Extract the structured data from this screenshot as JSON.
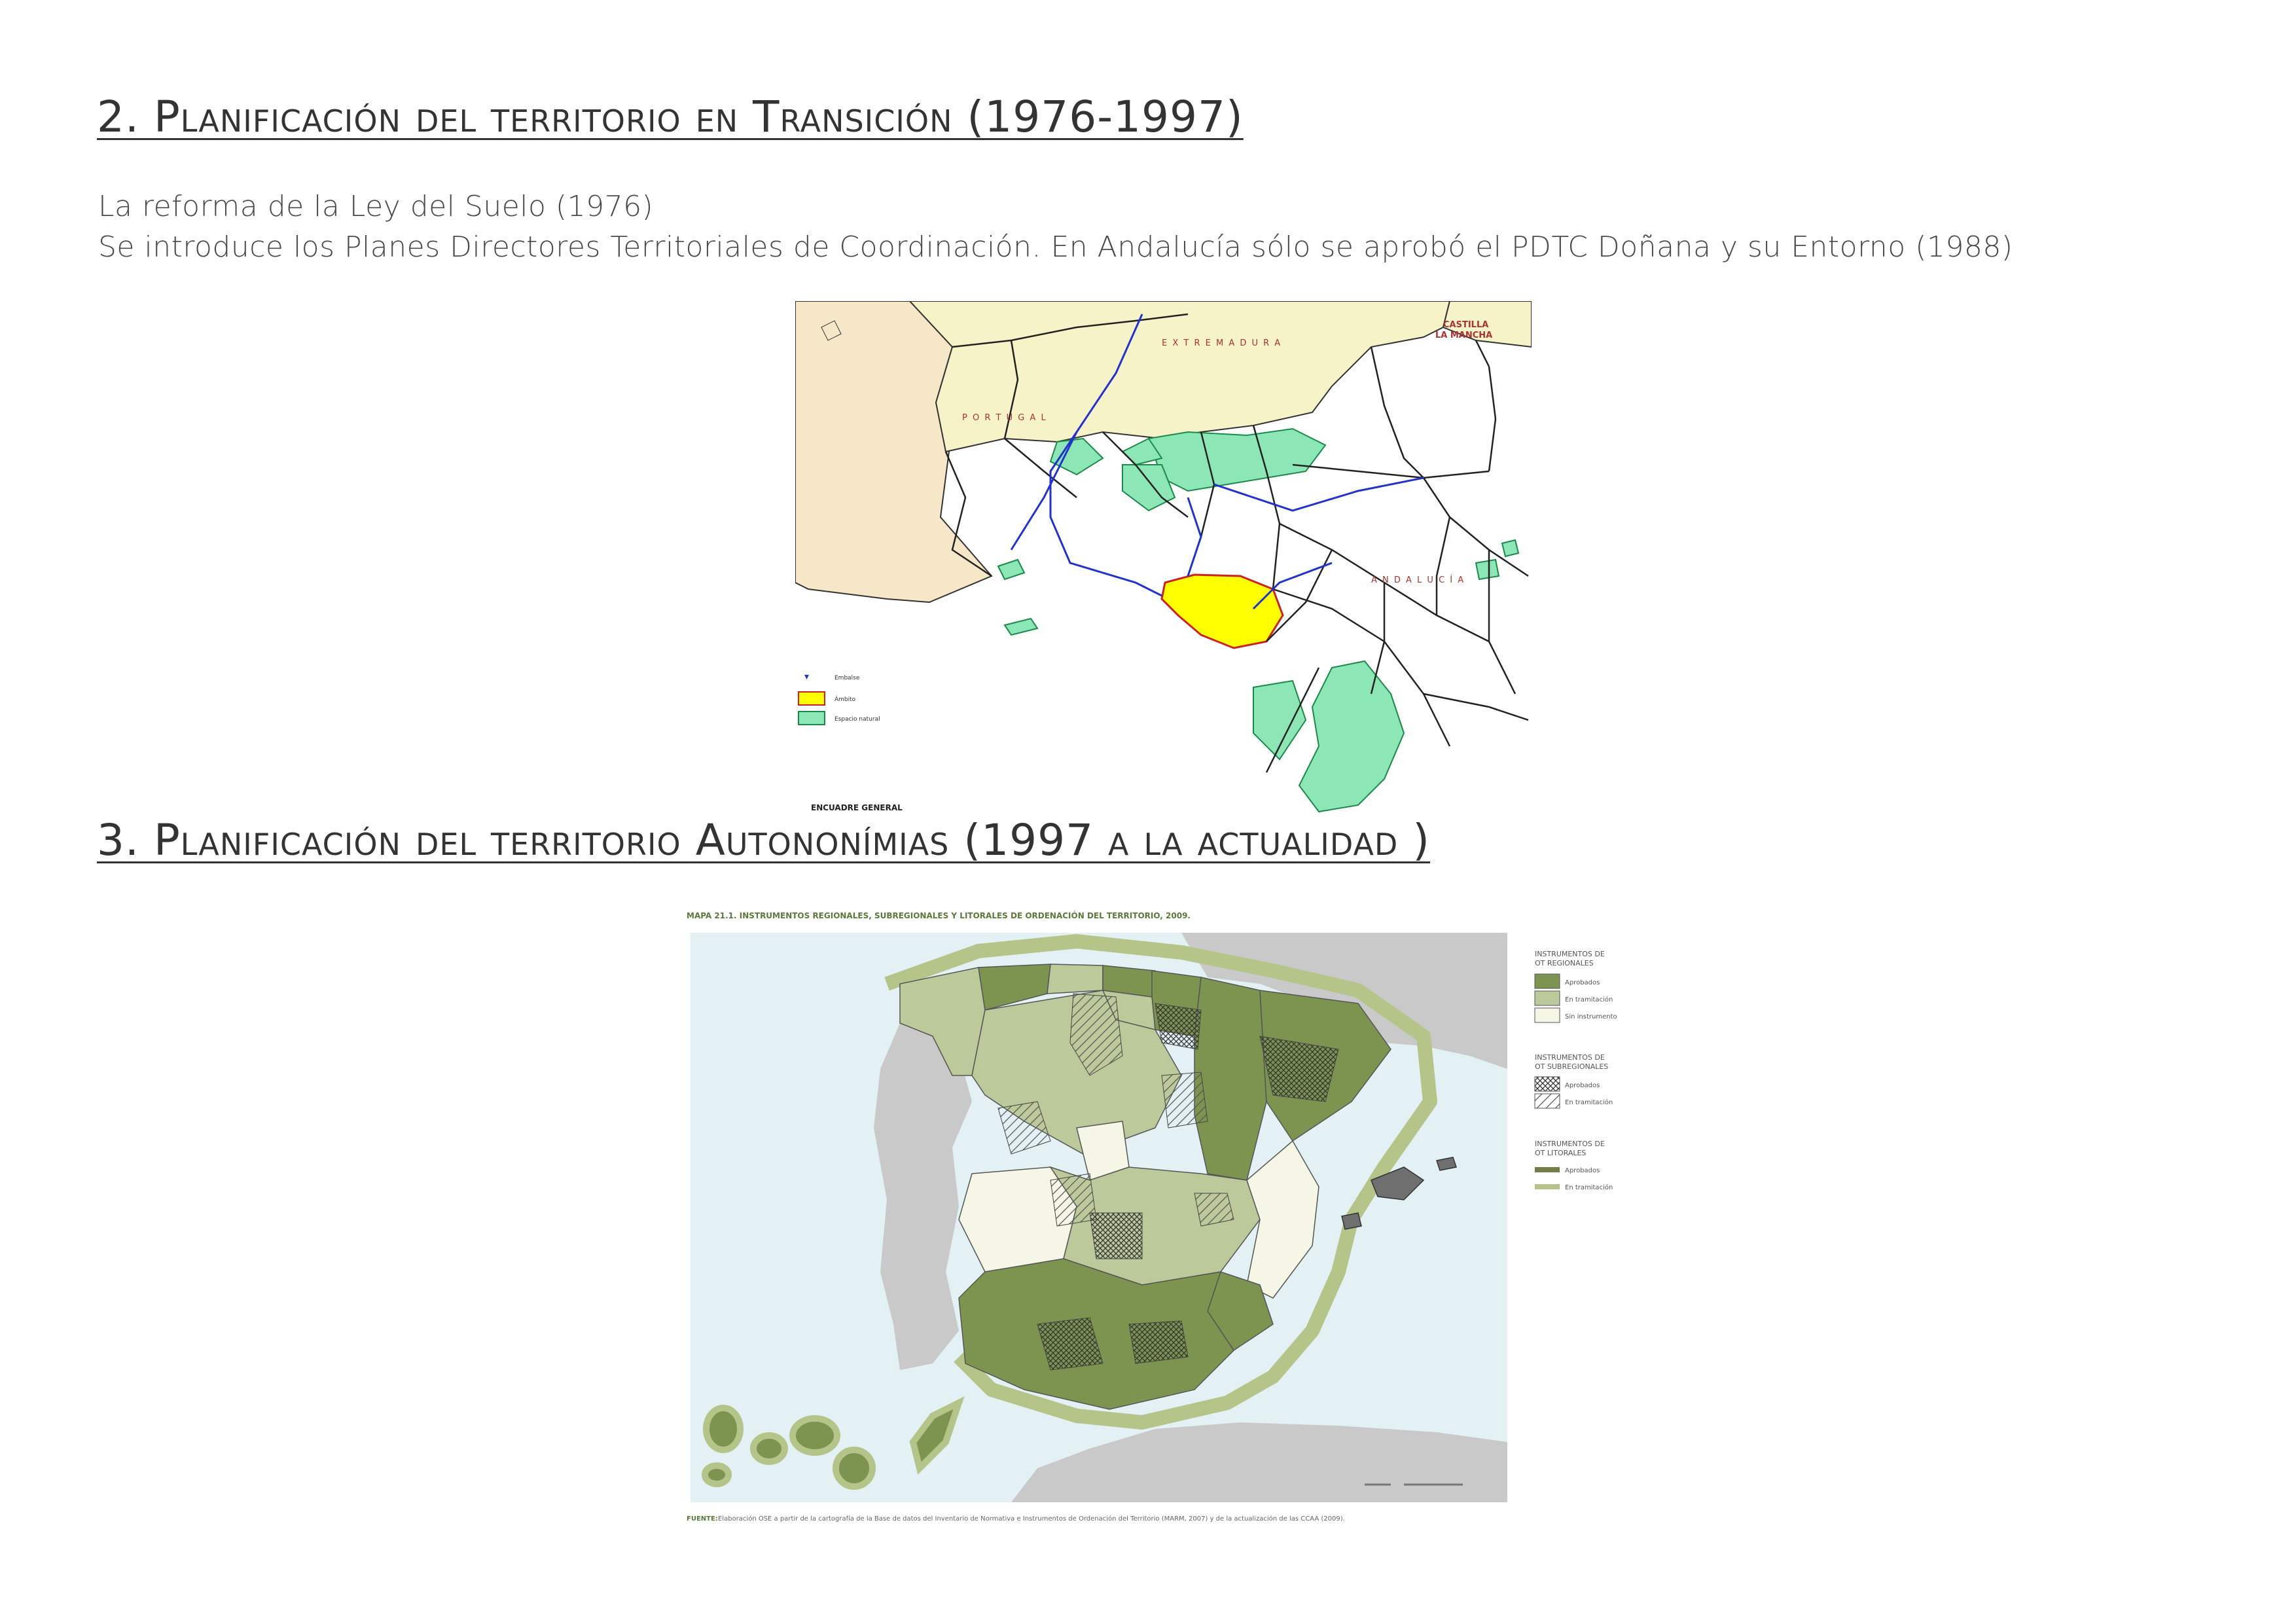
{
  "section2": {
    "heading": "2. Planificación del territorio en Transición (1976-1997)",
    "line1": "La reforma de la Ley del Suelo (1976)",
    "line2": "Se introduce los Planes Directores Territoriales de Coordinación. En Andalucía sólo se aprobó el PDTC Doñana y su Entorno (1988)"
  },
  "map1": {
    "labels": {
      "extremadura": "E X T R E M A D U R A",
      "castilla1": "CASTILLA",
      "castilla2": "LA MANCHA",
      "portugal": "P O R T U G A L",
      "andalucia": "A N D A L U C Í A"
    },
    "legend": [
      "Embalse",
      "Ámbito",
      "Espacio natural"
    ],
    "footer": "ENCUADRE GENERAL",
    "colors": {
      "portugal": "#f6e7c8",
      "extremadura": "#f7f3c9",
      "natural": "#8de6b6",
      "ambito": "#ffff00",
      "rivers": "#2233cc",
      "roads": "#222222"
    }
  },
  "section3": {
    "heading": "3. Planificación del territorio Autononímias (1997 a la actualidad )"
  },
  "map2": {
    "title": "MAPA 21.1. INSTRUMENTOS REGIONALES, SUBREGIONALES Y LITORALES DE ORDENACIÓN DEL TERRITORIO, 2009.",
    "legend_regional_title1": "INSTRUMENTOS DE",
    "legend_regional_title2": "OT REGIONALES",
    "legend_regional": [
      "Aprobados",
      "En tramitación",
      "Sin instrumento"
    ],
    "legend_subregional_title1": "INSTRUMENTOS DE",
    "legend_subregional_title2": "OT SUBREGIONALES",
    "legend_subregional": [
      "Aprobados",
      "En tramitación"
    ],
    "legend_litoral_title1": "INSTRUMENTOS DE",
    "legend_litoral_title2": "OT LITORALES",
    "legend_litoral": [
      "Aprobados",
      "En tramitación"
    ],
    "source_label": "FUENTE:",
    "source": "Elaboración OSE a partir de la cartografía de la Base de datos del Inventario de Normativa e Instrumentos de Ordenación del Territorio (MARM, 2007) y de la actualización de las CCAA (2009).",
    "colors": {
      "approved": "#7d9450",
      "in_process": "#bcc99a",
      "none": "#f6f6e6",
      "sea": "#e4f1f4",
      "other_land": "#c9c9c9"
    }
  }
}
